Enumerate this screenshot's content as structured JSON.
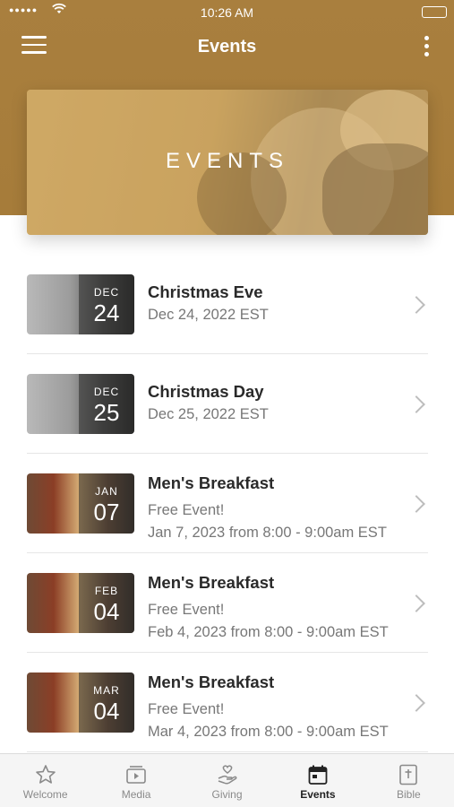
{
  "status_bar": {
    "signal": "●●●●●",
    "time": "10:26 AM"
  },
  "nav": {
    "title": "Events"
  },
  "hero": {
    "label": "EVENTS"
  },
  "events": [
    {
      "title": "Christmas Eve",
      "month": "DEC",
      "day": "24",
      "lines": [
        "Dec 24, 2022 EST"
      ],
      "image": "tree"
    },
    {
      "title": "Christmas Day",
      "month": "DEC",
      "day": "25",
      "lines": [
        "Dec 25, 2022 EST"
      ],
      "image": "tree"
    },
    {
      "title": "Men's Breakfast",
      "month": "JAN",
      "day": "07",
      "lines": [
        "Free Event!",
        "Jan 7, 2023 from 8:00 - 9:00am EST"
      ],
      "image": "food"
    },
    {
      "title": "Men's Breakfast",
      "month": "FEB",
      "day": "04",
      "lines": [
        "Free Event!",
        "Feb 4, 2023 from 8:00 - 9:00am EST"
      ],
      "image": "food"
    },
    {
      "title": "Men's Breakfast",
      "month": "MAR",
      "day": "04",
      "lines": [
        "Free Event!",
        "Mar 4, 2023 from 8:00 - 9:00am EST"
      ],
      "image": "food"
    }
  ],
  "tabs": [
    {
      "label": "Welcome",
      "icon": "star-icon",
      "active": false
    },
    {
      "label": "Media",
      "icon": "media-play-icon",
      "active": false
    },
    {
      "label": "Giving",
      "icon": "giving-hand-heart-icon",
      "active": false
    },
    {
      "label": "Events",
      "icon": "calendar-icon",
      "active": true
    },
    {
      "label": "Bible",
      "icon": "bible-icon",
      "active": false
    }
  ],
  "colors": {
    "header": "#a67c3a",
    "active_tab": "#222222",
    "inactive_tab": "#8a8a8a"
  }
}
